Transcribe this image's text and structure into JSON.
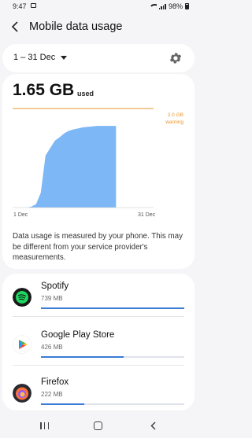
{
  "status": {
    "time": "9:47",
    "battery": "98%"
  },
  "header": {
    "title": "Mobile data usage"
  },
  "period": {
    "label": "1 – 31 Dec"
  },
  "usage": {
    "amount": "1.65 GB",
    "unit": "used",
    "warning_value": "2.0 GB",
    "warning_label": "warning",
    "x_start": "1 Dec",
    "x_end": "31 Dec",
    "disclaimer": "Data usage is measured by your phone. This may be different from your service provider's measurements."
  },
  "apps": [
    {
      "name": "Spotify",
      "size": "739 MB",
      "fraction": 1.0,
      "icon": "spotify-icon"
    },
    {
      "name": "Google Play Store",
      "size": "426 MB",
      "fraction": 0.576,
      "icon": "play-store-icon"
    },
    {
      "name": "Firefox",
      "size": "222 MB",
      "fraction": 0.3,
      "icon": "firefox-icon"
    }
  ],
  "colors": {
    "accent": "#3a7bd5",
    "chart_fill": "#7db7f5",
    "warning": "#e8952c"
  },
  "chart_data": {
    "type": "area",
    "x": [
      1,
      2,
      3,
      4,
      5,
      6,
      7,
      8,
      9,
      10,
      11,
      12,
      13,
      14,
      15,
      16,
      17,
      18,
      19,
      20,
      21,
      22,
      23,
      24,
      25,
      26,
      27,
      28,
      29,
      30,
      31
    ],
    "values": [
      0,
      0,
      0,
      0,
      0.02,
      0.07,
      0.3,
      1.05,
      1.2,
      1.35,
      1.42,
      1.5,
      1.55,
      1.58,
      1.6,
      1.62,
      1.63,
      1.64,
      1.65,
      1.65,
      1.65,
      1.65,
      1.65,
      null,
      null,
      null,
      null,
      null,
      null,
      null,
      null
    ],
    "ylim": [
      0,
      2.0
    ],
    "warning_line": 2.0,
    "title": "",
    "xlabel": "",
    "ylabel": ""
  }
}
